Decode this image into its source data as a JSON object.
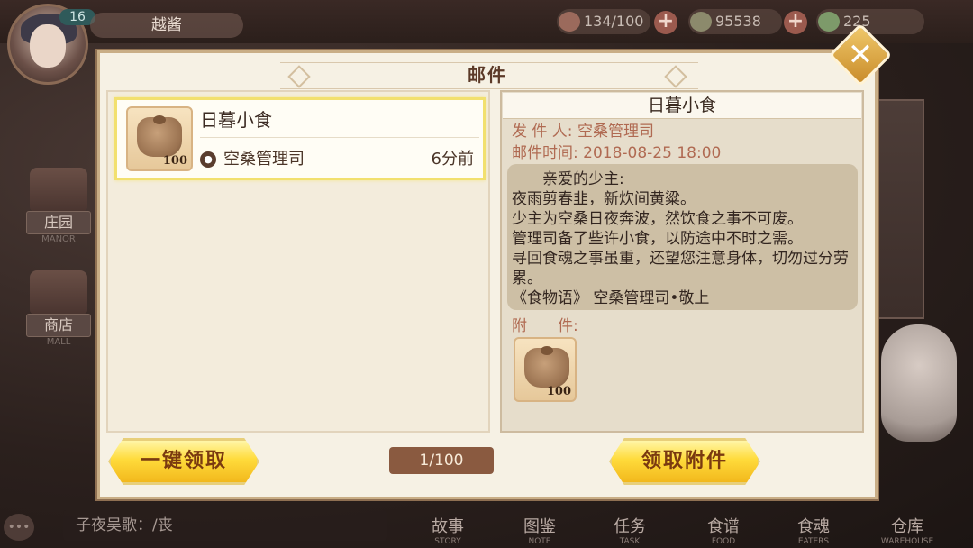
{
  "hud": {
    "level": "16",
    "player_name": "越酱",
    "stamina": "134/100",
    "coins": "95538",
    "gems": "225",
    "plus": "+"
  },
  "side_nav": [
    {
      "label": "庄园",
      "sub": "MANOR"
    },
    {
      "label": "商店",
      "sub": "MALL"
    }
  ],
  "bottom_nav": [
    {
      "label": "故事",
      "sub": "STORY"
    },
    {
      "label": "图鉴",
      "sub": "NOTE"
    },
    {
      "label": "任务",
      "sub": "TASK"
    },
    {
      "label": "食谱",
      "sub": "FOOD"
    },
    {
      "label": "食魂",
      "sub": "EATERS"
    },
    {
      "label": "仓库",
      "sub": "WAREHOUSE"
    }
  ],
  "chat": {
    "text": "子夜吴歌：/丧"
  },
  "mail": {
    "title": "邮件",
    "close": "✕",
    "list": [
      {
        "subject": "日暮小食",
        "sender": "空桑管理司",
        "time": "6分前",
        "qty": "100"
      }
    ],
    "detail": {
      "subject": "日暮小食",
      "sender_label": "发 件 人:",
      "sender": "空桑管理司",
      "time_label": "邮件时间:",
      "time": "2018-08-25  18:00",
      "body": "　　亲爱的少主:\n夜雨剪春韭，新炊间黄粱。\n少主为空桑日夜奔波，然饮食之事不可废。\n管理司备了些许小食，以防途中不时之需。\n寻回食魂之事虽重，还望您注意身体，切勿过分劳累。\n《食物语》 空桑管理司•敬上",
      "attach_label": "附　　件:",
      "attachments": [
        {
          "qty": "100"
        }
      ]
    },
    "claim_all": "一键领取",
    "claim_attach": "领取附件",
    "page": "1/100"
  }
}
